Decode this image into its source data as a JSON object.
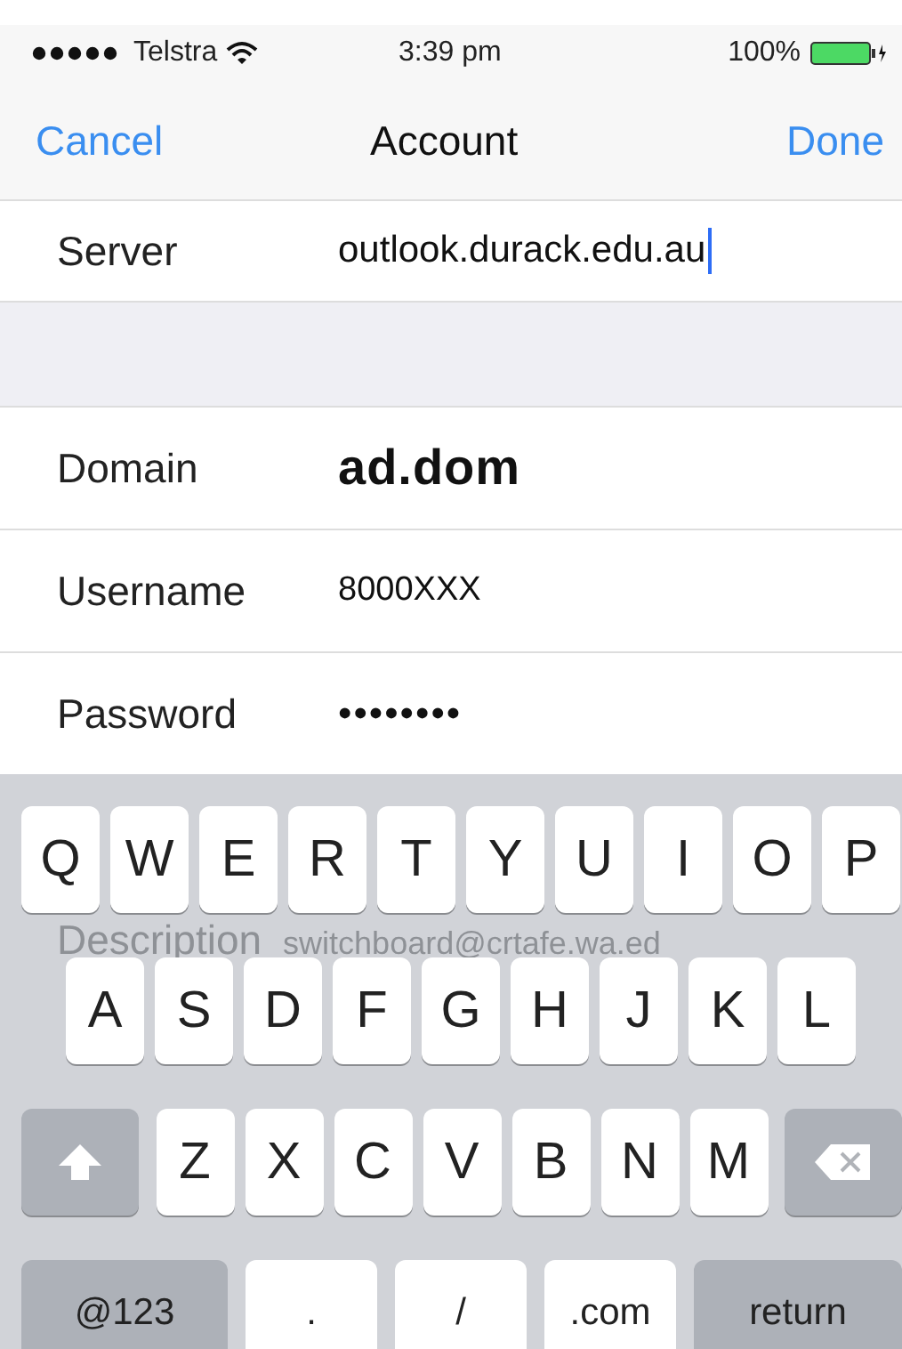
{
  "status_bar": {
    "carrier": "Telstra",
    "time": "3:39 pm",
    "battery": "100%"
  },
  "nav": {
    "cancel": "Cancel",
    "title": "Account",
    "done": "Done"
  },
  "server_row": {
    "label": "Server",
    "value": "outlook.durack.edu.au",
    "focused": true
  },
  "fields": [
    {
      "label": "Domain",
      "value": "ad.dom",
      "kind": "large"
    },
    {
      "label": "Username",
      "value": "8000XXX",
      "kind": "plain"
    },
    {
      "label": "Password",
      "value": "••••••••",
      "kind": "secure"
    }
  ],
  "behind_keyboard": {
    "label": "Description",
    "value": "switchboard@crtafe.wa.ed"
  },
  "keyboard": {
    "rows": [
      [
        "Q",
        "W",
        "E",
        "R",
        "T",
        "Y",
        "U",
        "I",
        "O",
        "P"
      ],
      [
        "A",
        "S",
        "D",
        "F",
        "G",
        "H",
        "J",
        "K",
        "L"
      ],
      [
        "Z",
        "X",
        "C",
        "V",
        "B",
        "N",
        "M"
      ]
    ],
    "bottom": [
      {
        "label": "@123",
        "kind": "function"
      },
      {
        "label": ".",
        "kind": "char"
      },
      {
        "label": "/",
        "kind": "char"
      },
      {
        "label": ".com",
        "kind": "char"
      },
      {
        "label": "return",
        "kind": "function"
      }
    ]
  }
}
